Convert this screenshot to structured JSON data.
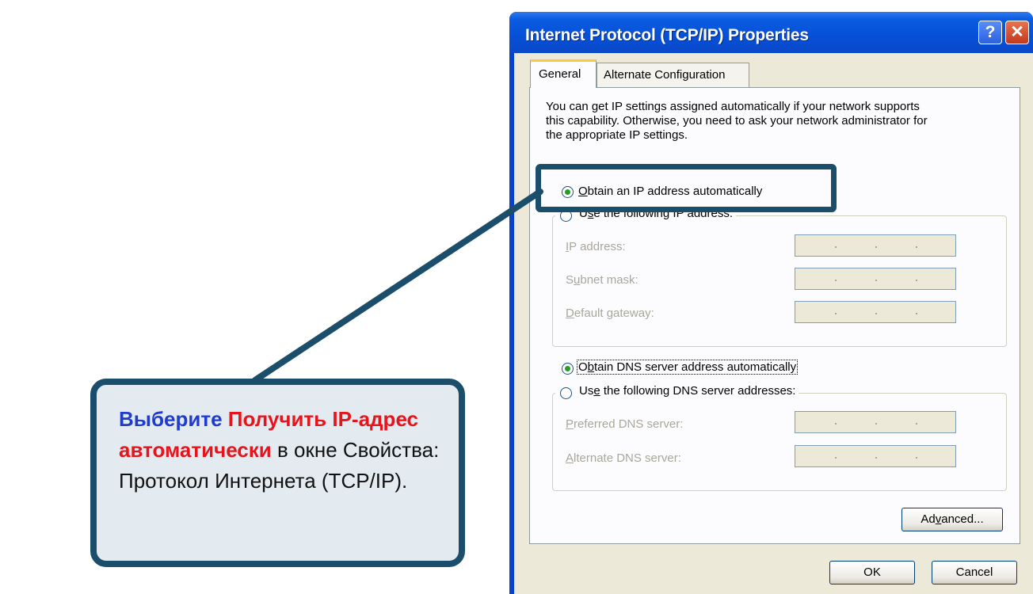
{
  "dialog": {
    "title": "Internet Protocol (TCP/IP) Properties",
    "help_button": "?",
    "close_button": "✕",
    "tabs": [
      {
        "label": "General"
      },
      {
        "label": "Alternate Configuration"
      }
    ],
    "intro_lines": [
      "You can get IP settings assigned automatically if your network supports",
      "this capability. Otherwise, you need to ask your network administrator for",
      "the appropriate IP settings."
    ],
    "ip": {
      "auto": {
        "pre": "",
        "key": "O",
        "post": "btain an IP address automatically",
        "selected": true
      },
      "manual": {
        "pre": "U",
        "key": "s",
        "post": "e the following IP address:",
        "selected": false
      },
      "fields": [
        {
          "pre": "",
          "key": "I",
          "post": "P address:",
          "value": "",
          "enabled": false
        },
        {
          "pre": "S",
          "key": "u",
          "post": "bnet mask:",
          "value": "",
          "enabled": false
        },
        {
          "pre": "",
          "key": "D",
          "post": "efault gateway:",
          "value": "",
          "enabled": false
        }
      ]
    },
    "dns": {
      "auto": {
        "pre": "O",
        "key": "b",
        "post": "tain DNS server address automatically",
        "selected": true
      },
      "manual": {
        "pre": "Us",
        "key": "e",
        "post": " the following DNS server addresses:",
        "selected": false
      },
      "fields": [
        {
          "pre": "",
          "key": "P",
          "post": "referred DNS server:",
          "value": "",
          "enabled": false
        },
        {
          "pre": "",
          "key": "A",
          "post": "lternate DNS server:",
          "value": "",
          "enabled": false
        }
      ]
    },
    "advanced_button": {
      "pre": "Ad",
      "key": "v",
      "post": "anced..."
    },
    "ok_button": "OK",
    "cancel_button": "Cancel"
  },
  "callout": {
    "part1": "Выберите ",
    "part2": "Получить IP-адрес",
    "part3": "автоматически",
    "part4": " в окне Свойства:",
    "part5": "Протокол Интернета (TCP/IP)."
  },
  "colors": {
    "callout_border": "#1b4e6a",
    "callout_fill": "#e3ebf0",
    "callout_blue": "#1f3ccf",
    "callout_red": "#e8141c",
    "titlebar": "#0650d8"
  }
}
